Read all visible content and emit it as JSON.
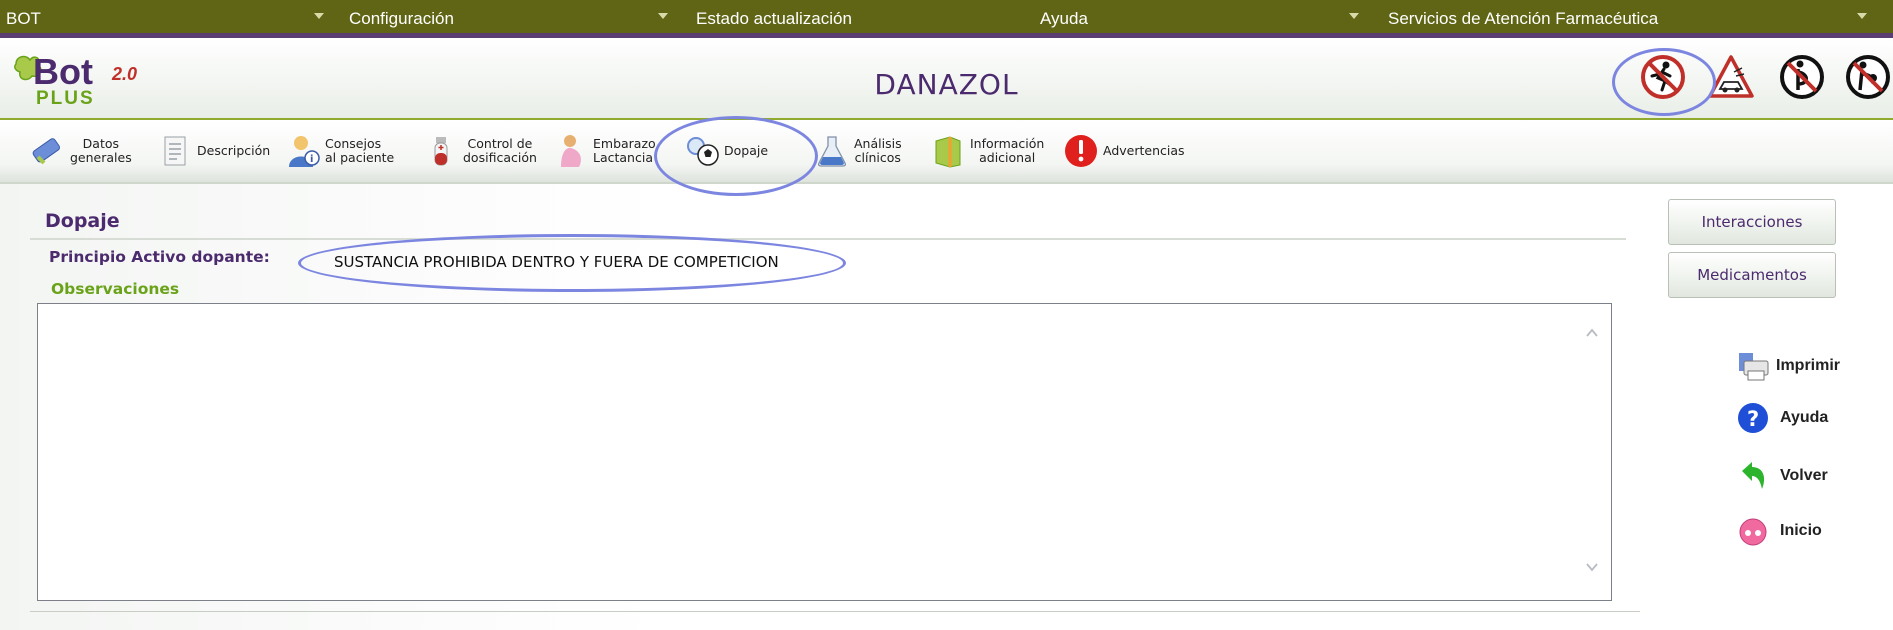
{
  "menubar": {
    "items": [
      {
        "label": "BOT"
      },
      {
        "label": "Configuración"
      },
      {
        "label": "Estado actualización"
      },
      {
        "label": "Ayuda"
      },
      {
        "label": "Servicios de Atención Farmacéutica"
      }
    ]
  },
  "header": {
    "logo_text": "Bot",
    "logo_sub": "PLUS",
    "logo_version": "2.0",
    "drug_name": "DANAZOL"
  },
  "toolbar": {
    "items": [
      {
        "label": "Datos\ngenerales"
      },
      {
        "label": "Descripción"
      },
      {
        "label": "Consejos\nal paciente"
      },
      {
        "label": "Control de\ndosificación"
      },
      {
        "label": "Embarazo\nLactancia"
      },
      {
        "label": "Dopaje"
      },
      {
        "label": "Análisis\nclínicos"
      },
      {
        "label": "Información\nadicional"
      },
      {
        "label": "Advertencias"
      }
    ]
  },
  "main": {
    "section_title": "Dopaje",
    "principio_label": "Principio Activo dopante:",
    "principio_value": "SUSTANCIA PROHIBIDA DENTRO Y FUERA DE COMPETICION",
    "observaciones_label": "Observaciones",
    "observaciones_value": ""
  },
  "sidebar": {
    "buttons": [
      {
        "label": "Interacciones"
      },
      {
        "label": "Medicamentos"
      }
    ],
    "actions": [
      {
        "label": "Imprimir"
      },
      {
        "label": "Ayuda"
      },
      {
        "label": "Volver"
      },
      {
        "label": "Inicio"
      }
    ]
  },
  "colors": {
    "menubar_bg": "#5f6514",
    "accent_purple": "#4b2a6e",
    "accent_green": "#6aa319",
    "highlight": "#7c86e0"
  }
}
